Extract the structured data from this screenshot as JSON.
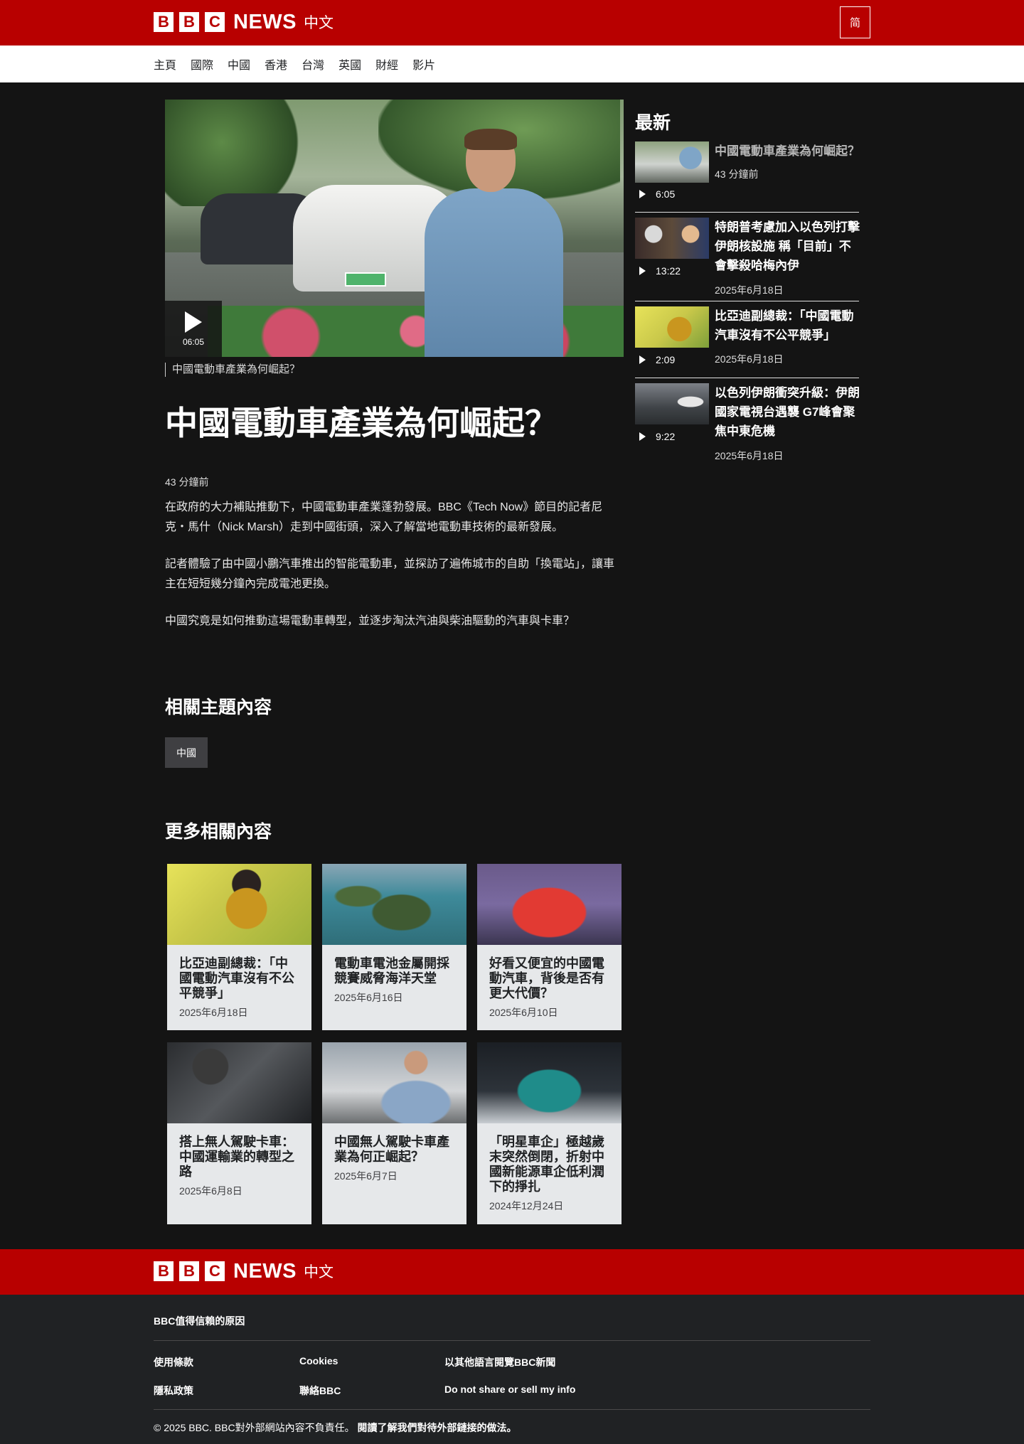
{
  "header": {
    "brand_letters": [
      "B",
      "B",
      "C"
    ],
    "brand_news": "NEWS",
    "brand_zh": "中文",
    "simplified_button": "简"
  },
  "nav": {
    "items": [
      "主頁",
      "國際",
      "中國",
      "香港",
      "台灣",
      "英國",
      "財經",
      "影片"
    ]
  },
  "video": {
    "duration": "06:05",
    "caption": "中國電動車產業為何崛起？"
  },
  "article": {
    "headline": "中國電動車產業為何崛起？",
    "timestamp": "43 分鐘前",
    "paragraphs": [
      "在政府的大力補貼推動下，中國電動車產業蓬勃發展。BBC《Tech Now》節目的記者尼克・馬什（Nick Marsh）走到中國街頭，深入了解當地電動車技術的最新發展。",
      "記者體驗了由中國小鵬汽車推出的智能電動車，並探訪了遍佈城市的自助「換電站」，讓車主在短短幾分鐘內完成電池更換。",
      "中國究竟是如何推動這場電動車轉型，並逐步淘汰汽油與柴油驅動的汽車與卡車？"
    ]
  },
  "related_topics": {
    "heading": "相關主題內容",
    "tags": [
      "中國"
    ]
  },
  "more_related": {
    "heading": "更多相關內容",
    "cards": [
      {
        "title": "比亞迪副總裁：「中國電動汽車沒有不公平競爭」",
        "date": "2025年6月18日"
      },
      {
        "title": "電動車電池金屬開採競賽威脅海洋天堂",
        "date": "2025年6月16日"
      },
      {
        "title": "好看又便宜的中國電動汽車，背後是否有更大代價？",
        "date": "2025年6月10日"
      },
      {
        "title": "搭上無人駕駛卡車：中國運輸業的轉型之路",
        "date": "2025年6月8日"
      },
      {
        "title": "中國無人駕駛卡車產業為何正崛起？",
        "date": "2025年6月7日"
      },
      {
        "title": "「明星車企」極越歲末突然倒閉，折射中國新能源車企低利潤下的掙扎",
        "date": "2024年12月24日"
      }
    ]
  },
  "sidebar": {
    "heading": "最新",
    "items": [
      {
        "title": "中國電動車產業為何崛起？",
        "date": "43 分鐘前",
        "duration": "6:05"
      },
      {
        "title": "特朗普考慮加入以色列打擊伊朗核設施 稱「目前」不會擊殺哈梅內伊",
        "date": "2025年6月18日",
        "duration": "13:22"
      },
      {
        "title": "比亞迪副總裁：「中國電動汽車沒有不公平競爭」",
        "date": "2025年6月18日",
        "duration": "2:09"
      },
      {
        "title": "以色列伊朗衝突升級：伊朗國家電視台遇襲 G7峰會聚焦中東危機",
        "date": "2025年6月18日",
        "duration": "9:22"
      }
    ]
  },
  "footer": {
    "trust_link": "BBC值得信賴的原因",
    "links": {
      "terms": "使用條款",
      "cookies": "Cookies",
      "other_lang": "以其他語言閱覽BBC新聞",
      "privacy": "隱私政策",
      "contact": "聯絡BBC",
      "dont_sell": "Do not share or sell my info"
    },
    "copyright": "© 2025 BBC. BBC對外部網站內容不負責任。",
    "external_link": "閱讀了解我們對待外部鏈接的做法。"
  }
}
